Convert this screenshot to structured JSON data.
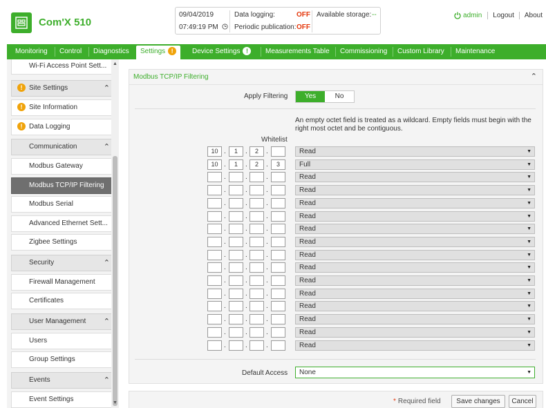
{
  "app": {
    "title": "Com'X 510"
  },
  "status": {
    "date": "09/04/2019",
    "time": "07:49:19 PM",
    "data_logging_label": "Data logging:",
    "data_logging_value": "OFF",
    "periodic_label": "Periodic publication:",
    "periodic_value": "OFF",
    "storage_label": "Available storage:",
    "storage_value": "--"
  },
  "user": {
    "name": "admin",
    "logout": "Logout",
    "about": "About"
  },
  "nav": {
    "monitoring": "Monitoring",
    "control": "Control",
    "diagnostics": "Diagnostics",
    "settings": "Settings",
    "device_settings": "Device Settings",
    "measurements_table": "Measurements Table",
    "commissioning": "Commissioning",
    "custom_library": "Custom Library",
    "maintenance": "Maintenance"
  },
  "sidebar": {
    "wifi_ap": "Wi-Fi Access Point Sett...",
    "site_settings": "Site Settings",
    "site_information": "Site Information",
    "data_logging": "Data Logging",
    "communication": "Communication",
    "modbus_gateway": "Modbus Gateway",
    "modbus_tcpip_filtering": "Modbus TCP/IP Filtering",
    "modbus_serial": "Modbus Serial",
    "advanced_ethernet": "Advanced Ethernet Sett...",
    "zigbee": "Zigbee Settings",
    "security": "Security",
    "firewall": "Firewall Management",
    "certificates": "Certificates",
    "user_management": "User Management",
    "users": "Users",
    "group_settings": "Group Settings",
    "events": "Events",
    "event_settings": "Event Settings"
  },
  "panel": {
    "title": "Modbus TCP/IP Filtering",
    "apply_filtering_label": "Apply Filtering",
    "yes": "Yes",
    "no": "No",
    "info_line1": "An empty octet field is treated as a wildcard. Empty fields must begin with the",
    "info_line2": "right most octet and be contiguous.",
    "whitelist_label": "Whitelist",
    "rows": [
      {
        "o1": "10",
        "o2": "1",
        "o3": "2",
        "o4": "",
        "access": "Read"
      },
      {
        "o1": "10",
        "o2": "1",
        "o3": "2",
        "o4": "3",
        "access": "Full"
      },
      {
        "o1": "",
        "o2": "",
        "o3": "",
        "o4": "",
        "access": "Read"
      },
      {
        "o1": "",
        "o2": "",
        "o3": "",
        "o4": "",
        "access": "Read"
      },
      {
        "o1": "",
        "o2": "",
        "o3": "",
        "o4": "",
        "access": "Read"
      },
      {
        "o1": "",
        "o2": "",
        "o3": "",
        "o4": "",
        "access": "Read"
      },
      {
        "o1": "",
        "o2": "",
        "o3": "",
        "o4": "",
        "access": "Read"
      },
      {
        "o1": "",
        "o2": "",
        "o3": "",
        "o4": "",
        "access": "Read"
      },
      {
        "o1": "",
        "o2": "",
        "o3": "",
        "o4": "",
        "access": "Read"
      },
      {
        "o1": "",
        "o2": "",
        "o3": "",
        "o4": "",
        "access": "Read"
      },
      {
        "o1": "",
        "o2": "",
        "o3": "",
        "o4": "",
        "access": "Read"
      },
      {
        "o1": "",
        "o2": "",
        "o3": "",
        "o4": "",
        "access": "Read"
      },
      {
        "o1": "",
        "o2": "",
        "o3": "",
        "o4": "",
        "access": "Read"
      },
      {
        "o1": "",
        "o2": "",
        "o3": "",
        "o4": "",
        "access": "Read"
      },
      {
        "o1": "",
        "o2": "",
        "o3": "",
        "o4": "",
        "access": "Read"
      },
      {
        "o1": "",
        "o2": "",
        "o3": "",
        "o4": "",
        "access": "Read"
      }
    ],
    "default_access_label": "Default Access",
    "default_access_value": "None"
  },
  "footer": {
    "required_field": "Required field",
    "save_changes": "Save changes",
    "cancel": "Cancel"
  },
  "colors": {
    "accent": "#3dae2b",
    "warning": "#f0a30a",
    "off": "#e4370b",
    "selected": "#6f6f6f"
  }
}
